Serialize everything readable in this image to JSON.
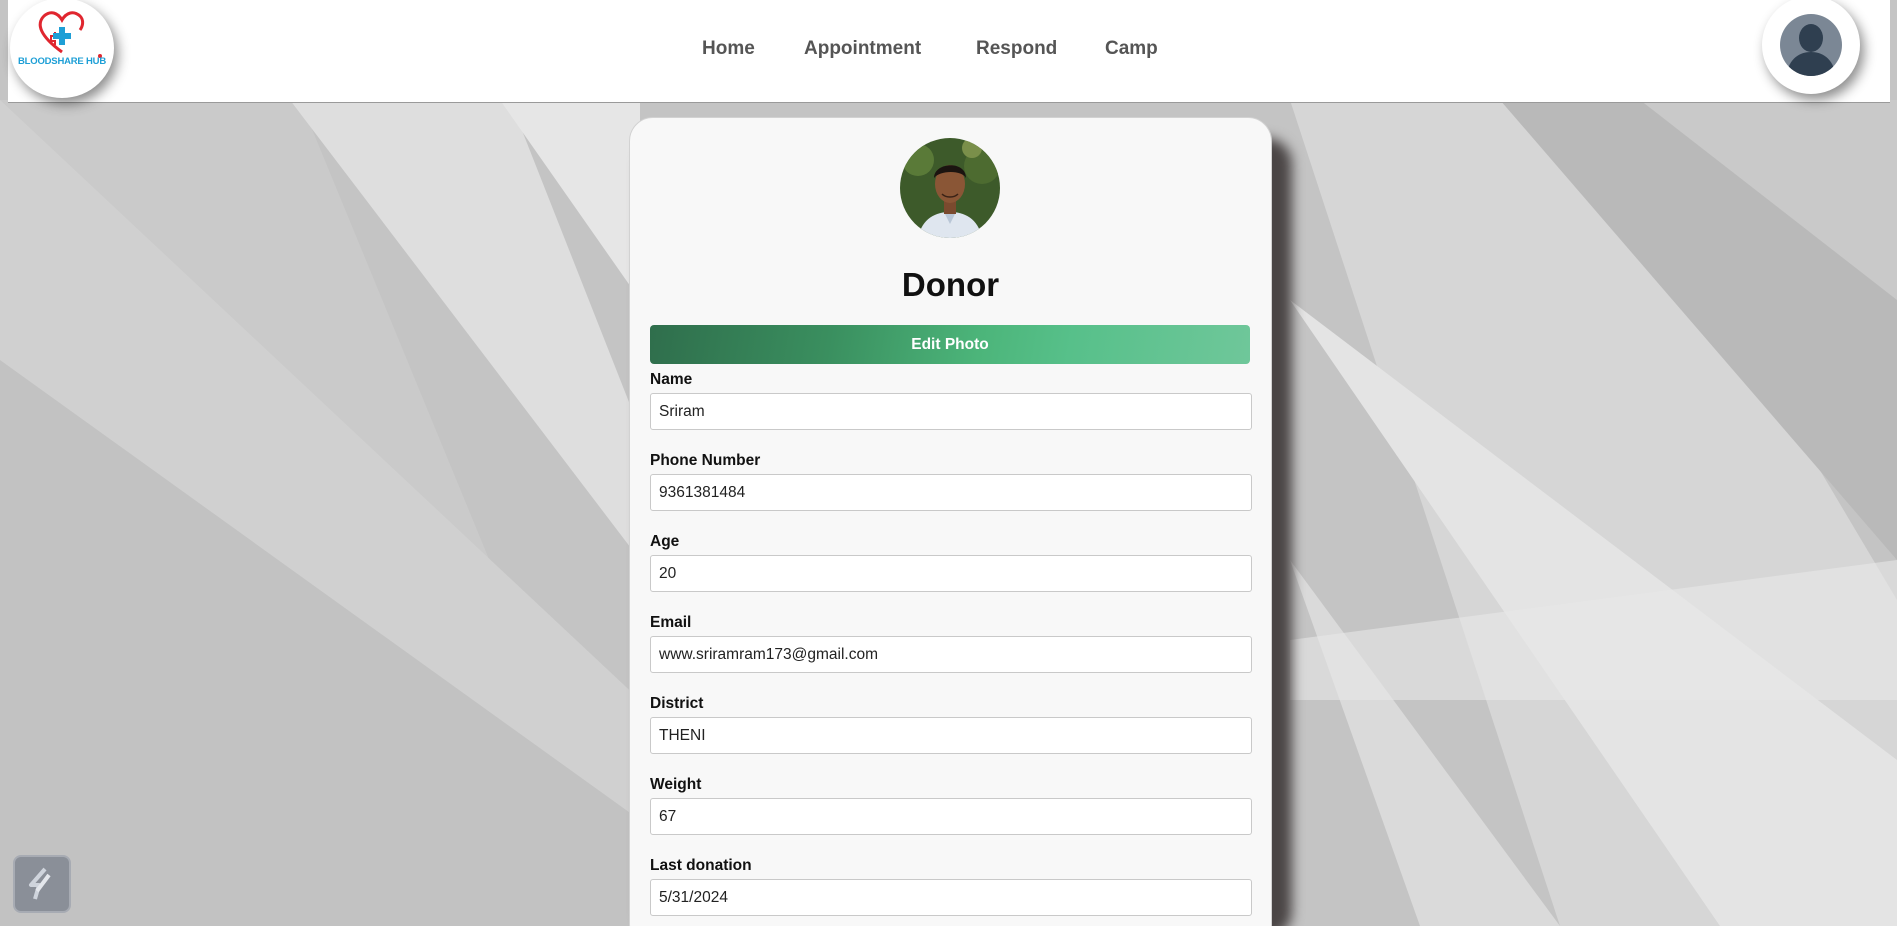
{
  "brand": {
    "logo_text": "BLOODSHARE HUB"
  },
  "nav": [
    {
      "label": "Home"
    },
    {
      "label": "Appointment"
    },
    {
      "label": "Respond"
    },
    {
      "label": "Camp"
    }
  ],
  "profile": {
    "role_title": "Donor",
    "edit_photo_label": "Edit Photo"
  },
  "fields": [
    {
      "label": "Name",
      "value": "Sriram"
    },
    {
      "label": "Phone Number",
      "value": "9361381484"
    },
    {
      "label": "Age",
      "value": "20"
    },
    {
      "label": "Email",
      "value": "www.sriramram173@gmail.com"
    },
    {
      "label": "District",
      "value": "THENI"
    },
    {
      "label": "Weight",
      "value": "67"
    },
    {
      "label": "Last donation",
      "value": "5/31/2024"
    }
  ],
  "colors": {
    "accent_green": "#4cb57a",
    "logo_red": "#e0262f",
    "logo_blue": "#1e9fd6"
  },
  "icons": {
    "logo": "heart-plus-icon",
    "avatar": "user-silhouette-icon",
    "floating_tool": "tool-badge-icon"
  }
}
